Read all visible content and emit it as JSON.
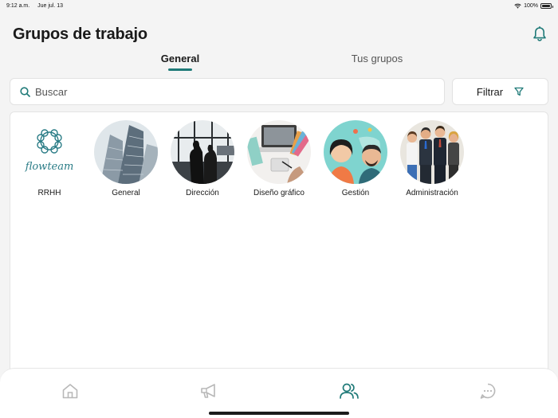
{
  "status": {
    "time": "9:12 a.m.",
    "date": "Jue jul. 13",
    "battery": "100%"
  },
  "header": {
    "title": "Grupos de trabajo"
  },
  "tabs": [
    {
      "label": "General",
      "active": true
    },
    {
      "label": "Tus grupos",
      "active": false
    }
  ],
  "search": {
    "placeholder": "Buscar",
    "value": ""
  },
  "filter": {
    "label": "Filtrar"
  },
  "groups": [
    {
      "name": "RRHH",
      "image": "flowteam-logo",
      "logo_text": "flowteam"
    },
    {
      "name": "General",
      "image": "skyscrapers-photo"
    },
    {
      "name": "Dirección",
      "image": "office-silhouettes-photo"
    },
    {
      "name": "Diseño gráfico",
      "image": "design-desk-photo"
    },
    {
      "name": "Gestión",
      "image": "people-illustration"
    },
    {
      "name": "Administración",
      "image": "business-team-illustration"
    }
  ],
  "bottom_nav": [
    {
      "icon": "home-icon",
      "active": false
    },
    {
      "icon": "megaphone-icon",
      "active": false
    },
    {
      "icon": "users-icon",
      "active": true
    },
    {
      "icon": "chat-icon",
      "active": false
    }
  ],
  "colors": {
    "accent": "#1f7a78",
    "inactive": "#b8b8b8",
    "background": "#f4f4f4"
  }
}
